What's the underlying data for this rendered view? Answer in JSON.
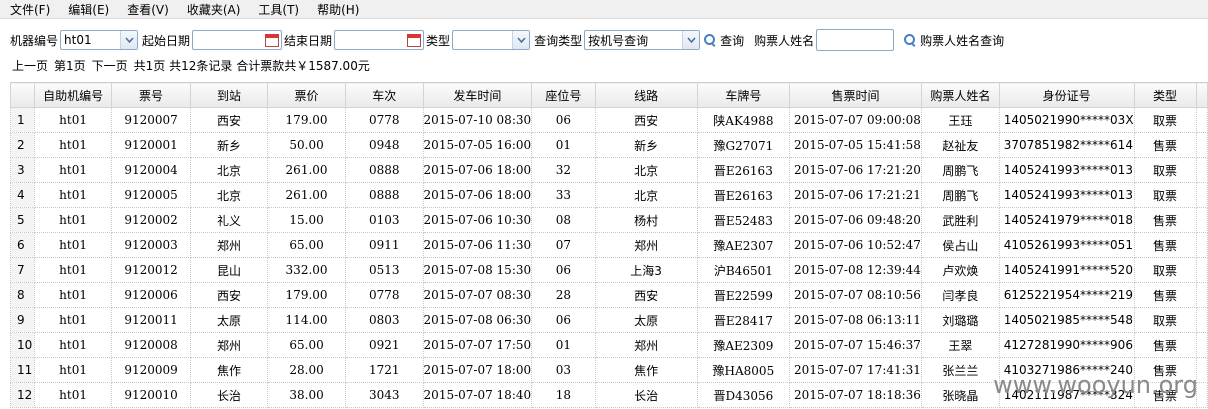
{
  "menu": [
    "文件(F)",
    "编辑(E)",
    "查看(V)",
    "收藏夹(A)",
    "工具(T)",
    "帮助(H)"
  ],
  "filters": {
    "machine_label": "机器编号",
    "machine_value": "ht01",
    "start_label": "起始日期",
    "end_label": "结束日期",
    "type_label": "类型",
    "type_value": "",
    "query_type_label": "查询类型",
    "query_type_value": "按机号查询",
    "query_button": "查询",
    "buyer_label": "购票人姓名",
    "buyer_query_button": "购票人姓名查询"
  },
  "pager": {
    "prev": "上一页",
    "page": "第1页",
    "next": "下一页",
    "summary": "共1页 共12条记录 合计票款共￥1587.00元"
  },
  "table": {
    "headers": [
      "自助机编号",
      "票号",
      "到站",
      "票价",
      "车次",
      "发车时间",
      "座位号",
      "线路",
      "车牌号",
      "售票时间",
      "购票人姓名",
      "身份证号",
      "类型"
    ],
    "rows": [
      [
        "1",
        "ht01",
        "9120007",
        "西安",
        "179.00",
        "0778",
        "2015-07-10 08:30",
        "06",
        "西安",
        "陕AK4988",
        "2015-07-07 09:00:08",
        "王珏",
        "1405021990*****03X",
        "取票"
      ],
      [
        "2",
        "ht01",
        "9120001",
        "新乡",
        "50.00",
        "0948",
        "2015-07-05 16:00",
        "01",
        "新乡",
        "豫G27071",
        "2015-07-05 15:41:58",
        "赵祉友",
        "3707851982*****614",
        "售票"
      ],
      [
        "3",
        "ht01",
        "9120004",
        "北京",
        "261.00",
        "0888",
        "2015-07-06 18:00",
        "32",
        "北京",
        "晋E26163",
        "2015-07-06 17:21:20",
        "周鹏飞",
        "1405241993*****013",
        "取票"
      ],
      [
        "4",
        "ht01",
        "9120005",
        "北京",
        "261.00",
        "0888",
        "2015-07-06 18:00",
        "33",
        "北京",
        "晋E26163",
        "2015-07-06 17:21:21",
        "周鹏飞",
        "1405241993*****013",
        "取票"
      ],
      [
        "5",
        "ht01",
        "9120002",
        "礼义",
        "15.00",
        "0103",
        "2015-07-06 10:30",
        "08",
        "杨村",
        "晋E52483",
        "2015-07-06 09:48:20",
        "武胜利",
        "1405241979*****018",
        "售票"
      ],
      [
        "6",
        "ht01",
        "9120003",
        "郑州",
        "65.00",
        "0911",
        "2015-07-06 11:30",
        "07",
        "郑州",
        "豫AE2307",
        "2015-07-06 10:52:47",
        "侯占山",
        "4105261993*****051",
        "售票"
      ],
      [
        "7",
        "ht01",
        "9120012",
        "昆山",
        "332.00",
        "0513",
        "2015-07-08 15:30",
        "06",
        "上海3",
        "沪B46501",
        "2015-07-08 12:39:44",
        "卢欢焕",
        "1405241991*****520",
        "取票"
      ],
      [
        "8",
        "ht01",
        "9120006",
        "西安",
        "179.00",
        "0778",
        "2015-07-07 08:30",
        "28",
        "西安",
        "晋E22599",
        "2015-07-07 08:10:56",
        "闫孝良",
        "6125221954*****219",
        "售票"
      ],
      [
        "9",
        "ht01",
        "9120011",
        "太原",
        "114.00",
        "0803",
        "2015-07-08 06:30",
        "06",
        "太原",
        "晋E28417",
        "2015-07-08 06:13:11",
        "刘璐璐",
        "1405021985*****548",
        "取票"
      ],
      [
        "10",
        "ht01",
        "9120008",
        "郑州",
        "65.00",
        "0921",
        "2015-07-07 17:50",
        "01",
        "郑州",
        "豫AE2309",
        "2015-07-07 15:46:37",
        "王翠",
        "4127281990*****906",
        "售票"
      ],
      [
        "11",
        "ht01",
        "9120009",
        "焦作",
        "28.00",
        "1721",
        "2015-07-07 18:00",
        "03",
        "焦作",
        "豫HA8005",
        "2015-07-07 17:41:31",
        "张兰兰",
        "4103271986*****240",
        "售票"
      ],
      [
        "12",
        "ht01",
        "9120010",
        "长治",
        "38.00",
        "3043",
        "2015-07-07 18:40",
        "18",
        "长治",
        "晋D43056",
        "2015-07-07 18:18:36",
        "张晓晶",
        "1402111987*****324",
        "售票"
      ]
    ]
  },
  "watermark": "www.wooyun.org"
}
